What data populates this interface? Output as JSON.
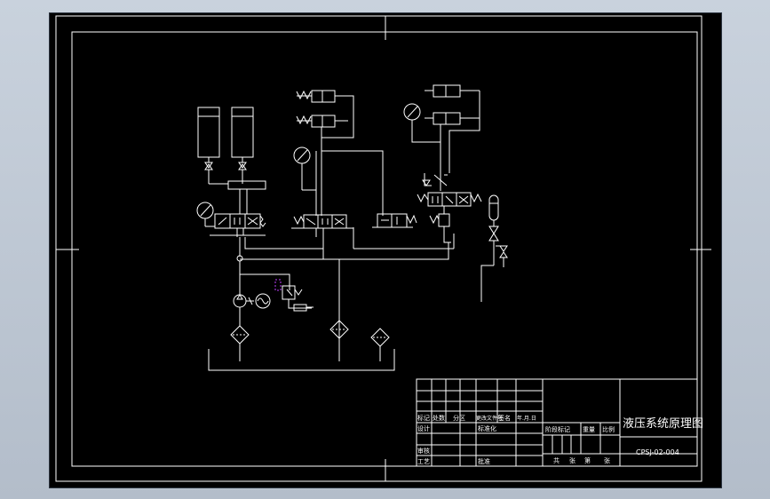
{
  "drawing": {
    "title": "液压系统原理图",
    "drawing_number": "CPSJ-02-004"
  },
  "title_block": {
    "row_labels": [
      "标记",
      "处数",
      "分区",
      "更改文件号",
      "签名",
      "年.月.日"
    ],
    "left_labels": [
      "设计",
      "审核",
      "工艺"
    ],
    "standardized": "标准化",
    "approved": "批准",
    "stage_headers": [
      "阶段标记",
      "重量",
      "比例"
    ],
    "sheet_info": [
      "共",
      "张",
      "第",
      "张"
    ]
  },
  "colors": {
    "background": "#000000",
    "line": "#ffffff",
    "accent": "#c040ff",
    "desktop": "#b7c1ce"
  },
  "symbols": [
    "hydraulic-cylinder-icon",
    "pressure-gauge-icon",
    "directional-valve-icon",
    "hydraulic-pump-icon",
    "electric-motor-icon",
    "relief-valve-icon",
    "filter-icon",
    "accumulator-icon",
    "check-valve-icon",
    "throttle-valve-icon",
    "oil-tank-icon"
  ]
}
